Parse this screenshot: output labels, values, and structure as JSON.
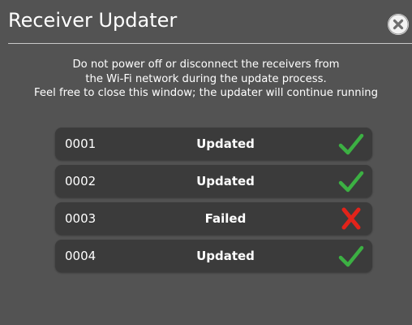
{
  "window": {
    "title": "Receiver Updater",
    "close_icon": "close-circle-icon"
  },
  "message": {
    "lines": [
      "Do not power off or disconnect the receivers from",
      "the Wi-Fi network during the update process.",
      "Feel free to close this window; the updater will continue running"
    ]
  },
  "receivers": [
    {
      "id": "0001",
      "status": "Updated",
      "icon": "checkmark-icon",
      "icon_color": "#3cb043"
    },
    {
      "id": "0002",
      "status": "Updated",
      "icon": "checkmark-icon",
      "icon_color": "#3cb043"
    },
    {
      "id": "0003",
      "status": "Failed",
      "icon": "x-mark-icon",
      "icon_color": "#e2231a"
    },
    {
      "id": "0004",
      "status": "Updated",
      "icon": "checkmark-icon",
      "icon_color": "#3cb043"
    }
  ],
  "colors": {
    "background": "#535353",
    "row_background": "#3b3b3b",
    "success": "#3cb043",
    "failure": "#e2231a"
  }
}
